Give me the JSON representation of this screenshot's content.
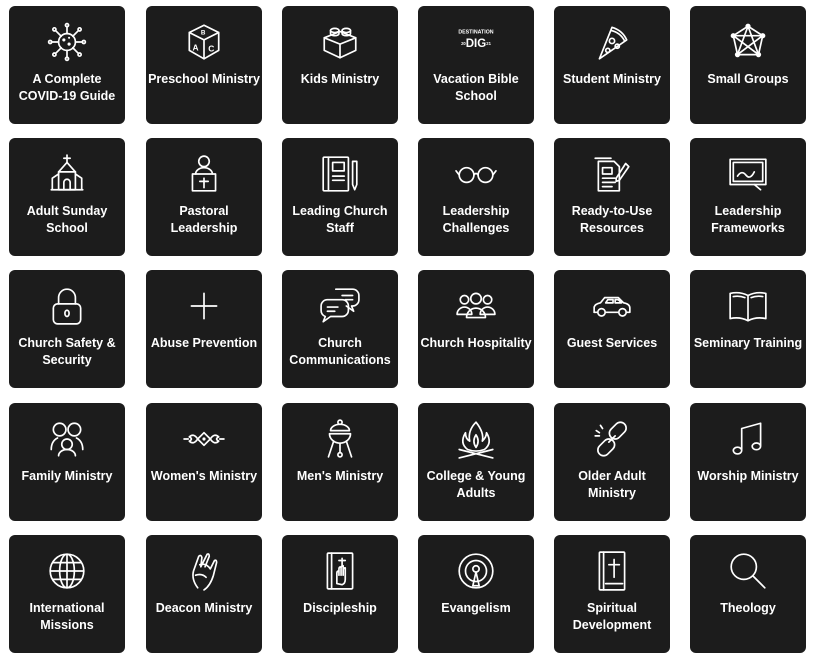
{
  "tiles": [
    {
      "label": "A Complete COVID-19 Guide",
      "icon": "virus-icon"
    },
    {
      "label": "Preschool Ministry",
      "icon": "abc-block-icon"
    },
    {
      "label": "Kids Ministry",
      "icon": "building-block-icon"
    },
    {
      "label": "Vacation Bible School",
      "icon": "destination-dig-logo-icon",
      "logo_text": [
        "DESTINATION",
        "20",
        "DIG",
        "21"
      ]
    },
    {
      "label": "Student Ministry",
      "icon": "pizza-slice-icon"
    },
    {
      "label": "Small Groups",
      "icon": "network-icon"
    },
    {
      "label": "Adult Sunday School",
      "icon": "church-building-icon"
    },
    {
      "label": "Pastoral Leadership",
      "icon": "pastor-pulpit-icon"
    },
    {
      "label": "Leading Church Staff",
      "icon": "notebook-pen-icon"
    },
    {
      "label": "Leadership Challenges",
      "icon": "glasses-icon"
    },
    {
      "label": "Ready-to-Use Resources",
      "icon": "document-pen-icon"
    },
    {
      "label": "Leadership Frameworks",
      "icon": "whiteboard-icon"
    },
    {
      "label": "Church Safety & Security",
      "icon": "padlock-icon"
    },
    {
      "label": "Abuse Prevention",
      "icon": "plus-icon"
    },
    {
      "label": "Church Communications",
      "icon": "chat-bubbles-icon"
    },
    {
      "label": "Church Hospitality",
      "icon": "people-group-icon"
    },
    {
      "label": "Guest Services",
      "icon": "car-icon"
    },
    {
      "label": "Seminary Training",
      "icon": "open-book-icon"
    },
    {
      "label": "Family Ministry",
      "icon": "family-icon"
    },
    {
      "label": "Women's Ministry",
      "icon": "floral-ornament-icon"
    },
    {
      "label": "Men's Ministry",
      "icon": "grill-icon"
    },
    {
      "label": "College & Young Adults",
      "icon": "campfire-icon"
    },
    {
      "label": "Older Adult Ministry",
      "icon": "chain-link-icon"
    },
    {
      "label": "Worship Ministry",
      "icon": "music-note-icon"
    },
    {
      "label": "International Missions",
      "icon": "globe-icon"
    },
    {
      "label": "Deacon Ministry",
      "icon": "helping-hands-icon"
    },
    {
      "label": "Discipleship",
      "icon": "bible-hand-icon"
    },
    {
      "label": "Evangelism",
      "icon": "broadcast-icon"
    },
    {
      "label": "Spiritual Development",
      "icon": "bible-cross-icon"
    },
    {
      "label": "Theology",
      "icon": "magnifier-icon"
    }
  ]
}
